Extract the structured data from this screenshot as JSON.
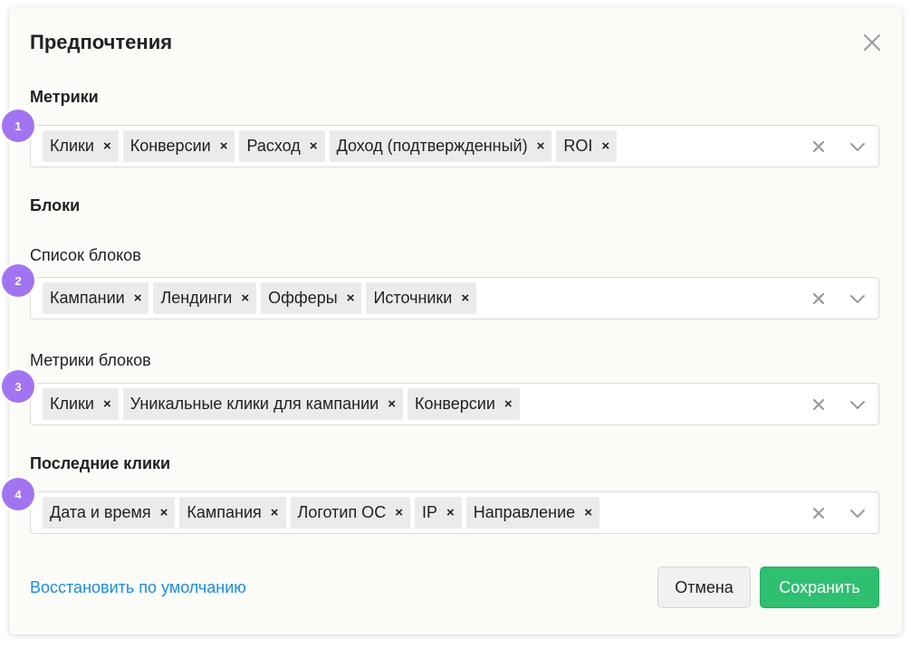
{
  "dialog": {
    "title": "Предпочтения"
  },
  "metrics": {
    "heading": "Метрики",
    "badge": "1",
    "tags": [
      "Клики",
      "Конверсии",
      "Расход",
      "Доход (подтвержденный)",
      "ROI"
    ]
  },
  "blocks": {
    "heading": "Блоки",
    "list": {
      "label": "Список блоков",
      "badge": "2",
      "tags": [
        "Кампании",
        "Лендинги",
        "Офферы",
        "Источники"
      ]
    },
    "metrics": {
      "label": "Метрики блоков",
      "badge": "3",
      "tags": [
        "Клики",
        "Уникальные клики для кампании",
        "Конверсии"
      ]
    }
  },
  "last_clicks": {
    "heading": "Последние клики",
    "badge": "4",
    "tags": [
      "Дата и время",
      "Кампания",
      "Логотип ОС",
      "IP",
      "Направление"
    ]
  },
  "footer": {
    "reset_label": "Восстановить по умолчанию",
    "cancel_label": "Отмена",
    "save_label": "Сохранить"
  },
  "icons": {
    "tag_remove": "×",
    "clear": "clear-x-icon",
    "chevron": "chevron-down-icon",
    "close": "close-icon"
  },
  "colors": {
    "accent_link": "#1a8ee8",
    "save_button": "#2fbf71",
    "badge": "#a374f2"
  }
}
